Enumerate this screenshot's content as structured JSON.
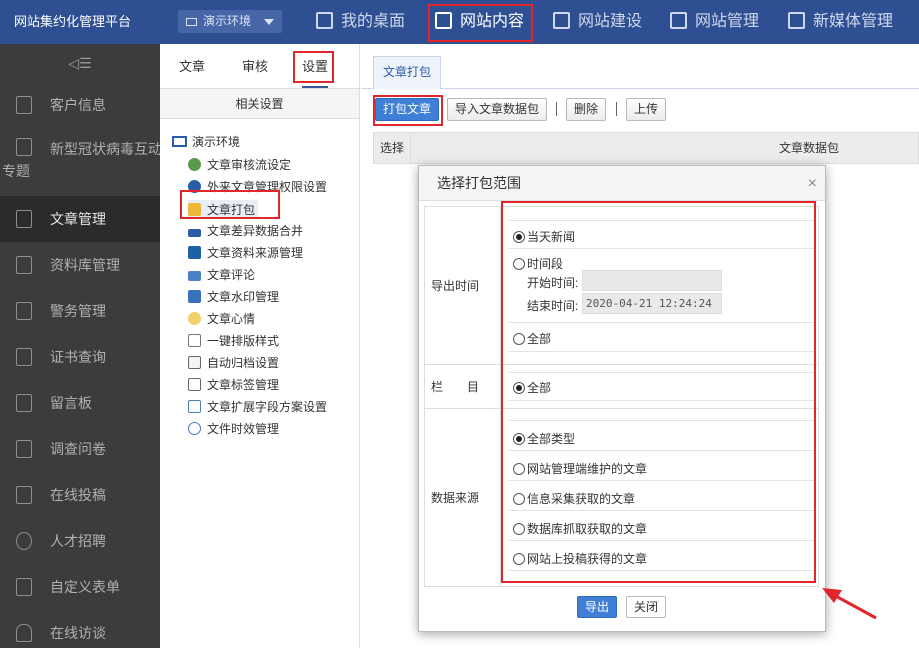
{
  "colors": {
    "topbar": "#2f4f93",
    "sidebar": "#3c3c3c",
    "accent": "#3f7fd6",
    "annotation_red": "#e0262b"
  },
  "topbar": {
    "brand": "网站集约化管理平台",
    "env_selector": "演示环境",
    "nav": [
      {
        "label": "我的桌面",
        "icon": "grid-icon"
      },
      {
        "label": "网站内容",
        "icon": "edit-icon"
      },
      {
        "label": "网站建设",
        "icon": "build-icon"
      },
      {
        "label": "网站管理",
        "icon": "monitor-icon"
      },
      {
        "label": "新媒体管理",
        "icon": "media-icon"
      }
    ]
  },
  "sidebar": {
    "collapse_glyph": "◁☰",
    "items": [
      {
        "label": "客户信息"
      },
      {
        "label": "新型冠状病毒互动",
        "label2": "专题"
      },
      {
        "label": "文章管理"
      },
      {
        "label": "资料库管理"
      },
      {
        "label": "警务管理"
      },
      {
        "label": "证书查询"
      },
      {
        "label": "留言板"
      },
      {
        "label": "调查问卷"
      },
      {
        "label": "在线投稿"
      },
      {
        "label": "人才招聘"
      },
      {
        "label": "自定义表单"
      },
      {
        "label": "在线访谈"
      }
    ]
  },
  "tree": {
    "tabs": [
      "文章",
      "审核",
      "设置"
    ],
    "header": "相关设置",
    "root": "演示环境",
    "nodes": [
      "文章审核流设定",
      "外来文章管理权限设置",
      "文章打包",
      "文章差异数据合并",
      "文章资料来源管理",
      "文章评论",
      "文章水印管理",
      "文章心情",
      "一键排版样式",
      "自动归档设置",
      "文章标签管理",
      "文章扩展字段方案设置",
      "文件时效管理"
    ]
  },
  "main": {
    "tab": "文章打包",
    "toolbar": {
      "pack": "打包文章",
      "import": "导入文章数据包",
      "delete": "删除",
      "upload": "上传"
    },
    "grid": {
      "col_select": "选择",
      "col_package": "文章数据包"
    }
  },
  "modal": {
    "title": "选择打包范围",
    "close": "×",
    "export_time": {
      "label": "导出时间",
      "today": "当天新闻",
      "period": "时间段",
      "start_label": "开始时间:",
      "start_value": "",
      "end_label": "结束时间:",
      "end_value": "2020-04-21 12:24:24",
      "all": "全部"
    },
    "column": {
      "label": "栏　　目",
      "all": "全部"
    },
    "source": {
      "label": "数据来源",
      "options": [
        "全部类型",
        "网站管理端维护的文章",
        "信息采集获取的文章",
        "数据库抓取获取的文章",
        "网站上投稿获得的文章"
      ]
    },
    "footer": {
      "export": "导出",
      "close": "关闭"
    }
  }
}
